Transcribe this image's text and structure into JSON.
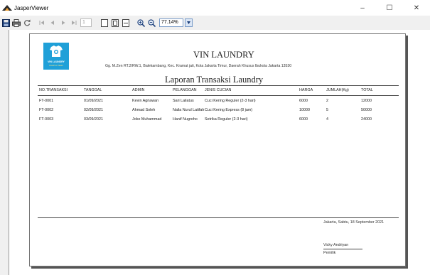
{
  "window": {
    "title": "JasperViewer",
    "minimize_label": "–",
    "maximize_label": "☐",
    "close_label": "✕"
  },
  "toolbar": {
    "page_number": "1",
    "zoom_value": "77.14%"
  },
  "report": {
    "logo": {
      "name": "VIN LAUNDRY",
      "tagline": "Fresh & Clean"
    },
    "company_name": "VIN LAUNDRY",
    "address": "Gg. M.Zen RT.2/RW.1, Balekambang, Kec. Kramat jati, Kota Jakarta Timur, Daerah Khusus Ibukota Jakarta 13530",
    "title": "Laporan Transaksi Laundry",
    "columns": [
      "NO.TRANSAKSI",
      "TANGGAL",
      "ADMIN",
      "PELANGGAN",
      "JENIS CUCIAN",
      "HARGA",
      "JUMLAH(Kg)",
      "TOTAL"
    ],
    "rows": [
      [
        "FT-0001",
        "01/09/2021",
        "Kevin Agriawan",
        "Sari Lailatus",
        "Cuci Kering Reguler (2-3 hari)",
        "6000",
        "2",
        "12000"
      ],
      [
        "FT-0002",
        "02/09/2021",
        "Ahmad Soleh",
        "Naila Nurul Latifah",
        "Cuci Kering Express (8 jam)",
        "10000",
        "5",
        "50000"
      ],
      [
        "FT-0003",
        "03/09/2021",
        "Joko Muhammad",
        "Hanif Nugroho",
        "Setrika Reguler (2-3 hari)",
        "6000",
        "4",
        "24000"
      ]
    ],
    "footer": {
      "date_line": "Jakarta, Sabtu, 18 September 2021",
      "signer_name": "Vicky Andriyan",
      "signer_role": "Pemilik"
    }
  },
  "colors": {
    "logo_background": "#1fa0d8",
    "zoom_field_border": "#7a9cc9"
  }
}
